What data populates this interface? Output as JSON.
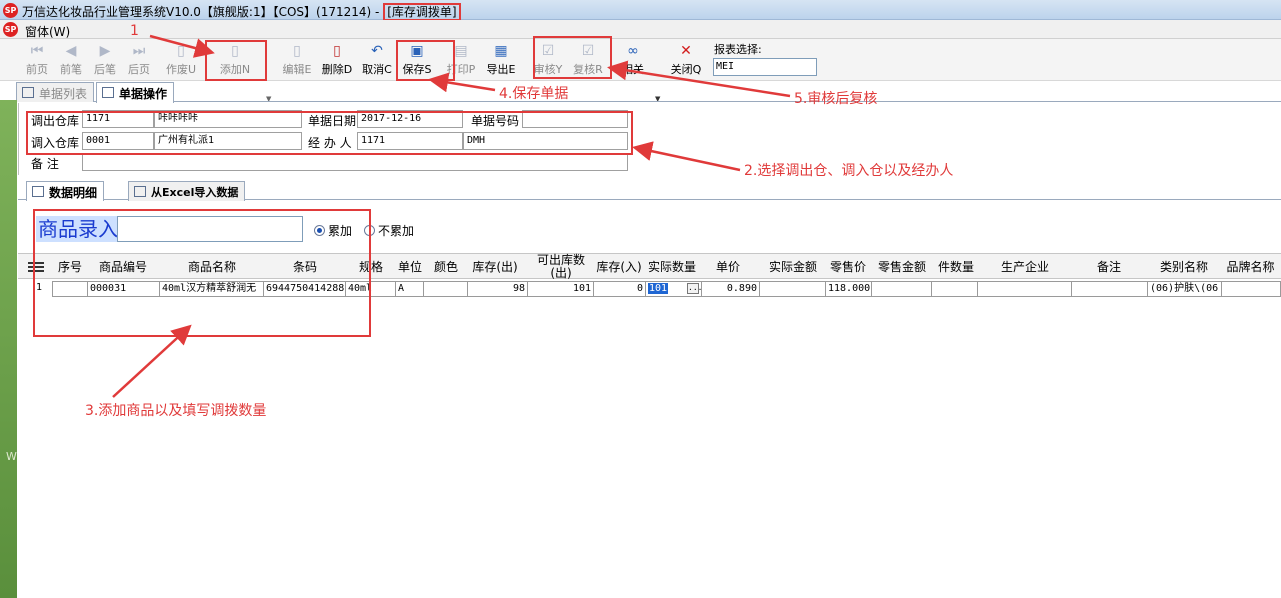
{
  "window": {
    "title": "万信达化妆品行业管理系统V10.0【旗舰版:1】【COS】(171214) - ",
    "title_highlight": "[库存调拨单]",
    "logo_text": "SP"
  },
  "menu": {
    "window_label": "窗体(W)"
  },
  "toolbar": {
    "buttons": [
      {
        "label": "前页",
        "icon": "first-page-icon"
      },
      {
        "label": "前笔",
        "icon": "prev-record-icon"
      },
      {
        "label": "后笔",
        "icon": "next-record-icon"
      },
      {
        "label": "后页",
        "icon": "last-page-icon"
      },
      {
        "label": "作废U",
        "icon": "void-icon"
      },
      {
        "label": "添加N",
        "icon": "add-doc-icon"
      },
      {
        "label": "编辑E",
        "icon": "edit-doc-icon"
      },
      {
        "label": "删除D",
        "icon": "delete-doc-icon"
      },
      {
        "label": "取消C",
        "icon": "undo-icon"
      },
      {
        "label": "保存S",
        "icon": "save-disk-icon"
      },
      {
        "label": "打印P",
        "icon": "printer-icon"
      },
      {
        "label": "导出E",
        "icon": "export-icon"
      },
      {
        "label": "审核Y",
        "icon": "approve-icon"
      },
      {
        "label": "复核R",
        "icon": "review-icon"
      },
      {
        "label": "相关",
        "icon": "link-icon"
      },
      {
        "label": "关闭Q",
        "icon": "close-x-icon"
      }
    ],
    "report_select_label": "报表选择:",
    "report_select_value": "MEI"
  },
  "tabs_top": {
    "list_label": "单据列表",
    "op_label": "单据操作"
  },
  "form": {
    "out_wh_label": "调出仓库",
    "out_wh_code": "1171",
    "out_wh_name": "咔咔咔咔",
    "date_label": "单据日期",
    "date_value": "2017-12-16",
    "docno_label": "单据号码",
    "docno_value": "",
    "in_wh_label": "调入仓库",
    "in_wh_code": "0001",
    "in_wh_name": "广州有礼派1",
    "handler_label": "经 办 人",
    "handler_code": "1171",
    "handler_name": "DMH",
    "remark_label": "备    注",
    "remark_value": ""
  },
  "tabs_detail": {
    "detail_label": "数据明细",
    "excel_label": "从Excel导入数据"
  },
  "entry": {
    "label": "商品录入",
    "input_value": "",
    "radio_accumulate": "累加",
    "radio_no_accumulate": "不累加"
  },
  "grid": {
    "columns": [
      "序号",
      "商品编号",
      "商品名称",
      "条码",
      "规格",
      "单位",
      "颜色",
      "库存(出)",
      "可出库数(出)",
      "库存(入)",
      "实际数量",
      "单价",
      "实际金额",
      "零售价",
      "零售金额",
      "件数量",
      "生产企业",
      "备注",
      "类别名称",
      "品牌名称"
    ],
    "rows": [
      {
        "no": "1",
        "code": "000031",
        "name": "40ml汉方精萃舒润无",
        "barcode": "6944750414288",
        "spec": "40ml",
        "unit": "A",
        "color": "",
        "stock_out": "98",
        "avail_out": "101",
        "stock_in": "0",
        "qty": "101",
        "qty_button": "...",
        "price": "0.890",
        "amount": "",
        "retail": "118.000",
        "retail_amt": "",
        "pieces": "",
        "maker": "",
        "remark": "",
        "category": "(06)护肤\\(06",
        "brand": ""
      }
    ]
  },
  "annotations": {
    "a1": "1",
    "a2": "2.选择调出仓、调入仓以及经办人",
    "a3": "3.添加商品以及填写调拨数量",
    "a4": "4.保存单据",
    "a5": "5.审核后复核"
  },
  "colors": {
    "annotation_red": "#e03a3a",
    "entry_blue": "#1a3bcf",
    "selection_blue": "#1f66d3"
  },
  "left_strip_text": "W"
}
